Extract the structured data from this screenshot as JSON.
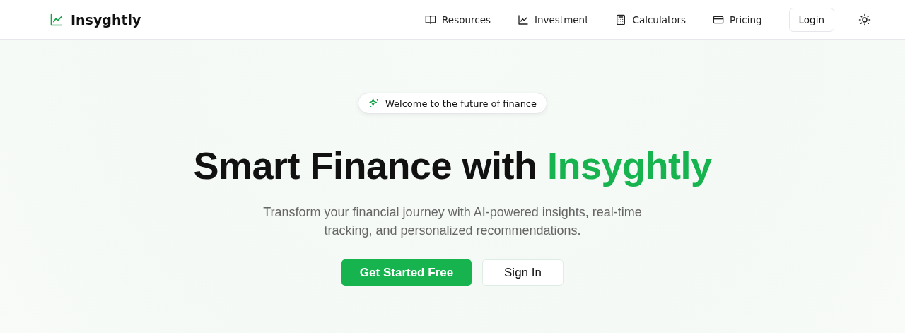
{
  "brand": {
    "name": "Insyghtly"
  },
  "nav": [
    {
      "label": "Resources"
    },
    {
      "label": "Investment"
    },
    {
      "label": "Calculators"
    },
    {
      "label": "Pricing"
    }
  ],
  "login": "Login",
  "badge": "Welcome to the future of finance",
  "headline": {
    "text": "Smart Finance with",
    "accent": "Insyghtly"
  },
  "subtitle": "Transform your financial journey with AI-powered insights, real-time tracking, and personalized recommendations.",
  "buttons": [
    {
      "label": "Get Started Free",
      "kind": "primary"
    },
    {
      "label": "Sign In",
      "kind": "secondary"
    }
  ]
}
